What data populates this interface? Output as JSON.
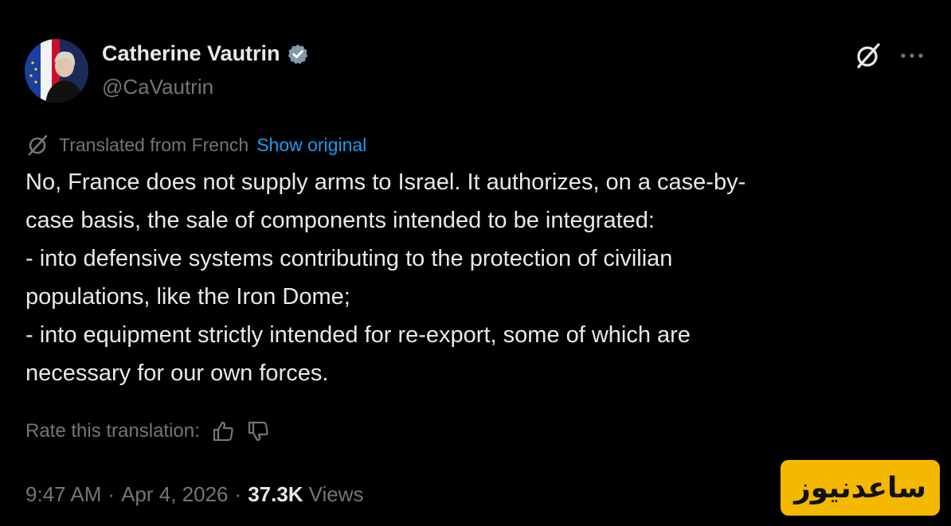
{
  "author": {
    "name": "Catherine Vautrin",
    "handle": "@CaVautrin"
  },
  "translation": {
    "label": "Translated from French",
    "show_original": "Show original"
  },
  "tweet": {
    "lines": [
      "No, France does not supply arms to Israel. It authorizes, on a case-by-",
      "case basis, the sale of components intended to be integrated:",
      "- into defensive systems contributing to the protection of civilian",
      "populations, like the Iron Dome;",
      "- into equipment strictly intended for re-export, some of which are",
      "necessary for our own forces."
    ]
  },
  "rate": {
    "label": "Rate this translation:"
  },
  "meta": {
    "time": "9:47 AM",
    "separator": "·",
    "date": "Apr 4, 2026",
    "views_count": "37.3K",
    "views_label": "Views"
  },
  "watermark": {
    "text": "ساعدنیوز"
  },
  "icons": {
    "verified": "verified-badge-icon",
    "grok": "grok-icon",
    "more": "more-dots-icon",
    "translate": "grok-translate-icon",
    "thumbs_up": "thumbs-up-icon",
    "thumbs_down": "thumbs-down-icon"
  },
  "colors": {
    "background": "#000000",
    "text": "#e7e9ea",
    "secondary": "#71767b",
    "link": "#1d9bf0",
    "watermark_bg": "#f5b800"
  }
}
